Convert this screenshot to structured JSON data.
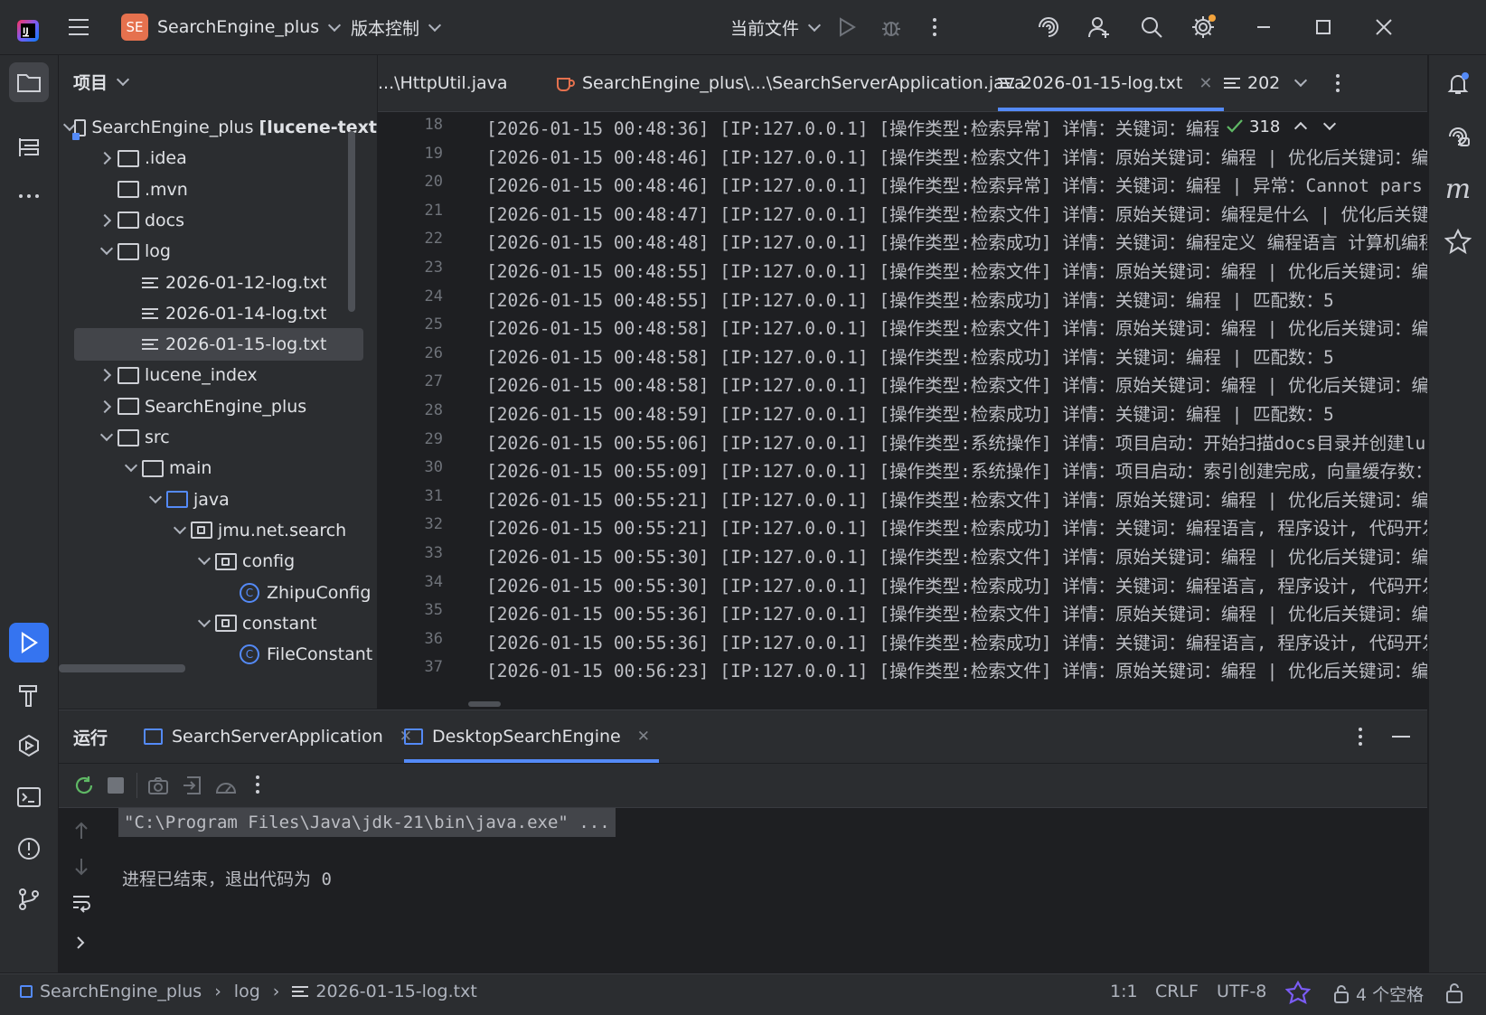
{
  "titlebar": {
    "project_badge": "SE",
    "project_name": "SearchEngine_plus",
    "vcs_menu": "版本控制",
    "run_config": "当前文件"
  },
  "project_panel": {
    "title": "项目",
    "tree": [
      {
        "label": "SearchEngine_plus",
        "suffix": "[lucene-text",
        "kind": "module",
        "level": 0,
        "expanded": true
      },
      {
        "label": ".idea",
        "kind": "folder",
        "level": 1,
        "expanded": false
      },
      {
        "label": ".mvn",
        "kind": "folder",
        "level": 1,
        "expanded": null
      },
      {
        "label": "docs",
        "kind": "folder",
        "level": 1,
        "expanded": false
      },
      {
        "label": "log",
        "kind": "folder",
        "level": 1,
        "expanded": true
      },
      {
        "label": "2026-01-12-log.txt",
        "kind": "file",
        "level": 2
      },
      {
        "label": "2026-01-14-log.txt",
        "kind": "file",
        "level": 2
      },
      {
        "label": "2026-01-15-log.txt",
        "kind": "file",
        "level": 2,
        "selected": true
      },
      {
        "label": "lucene_index",
        "kind": "folder",
        "level": 1,
        "expanded": false
      },
      {
        "label": "SearchEngine_plus",
        "kind": "folder",
        "level": 1,
        "expanded": false
      },
      {
        "label": "src",
        "kind": "folder",
        "level": 1,
        "expanded": true
      },
      {
        "label": "main",
        "kind": "folder",
        "level": 2,
        "expanded": true
      },
      {
        "label": "java",
        "kind": "folder-blue",
        "level": 3,
        "expanded": true
      },
      {
        "label": "jmu.net.search",
        "kind": "package",
        "level": 4,
        "expanded": true
      },
      {
        "label": "config",
        "kind": "package",
        "level": 5,
        "expanded": true
      },
      {
        "label": "ZhipuConfig",
        "kind": "class",
        "level": 6
      },
      {
        "label": "constant",
        "kind": "package",
        "level": 5,
        "expanded": true
      },
      {
        "label": "FileConstant",
        "kind": "class",
        "level": 6
      }
    ]
  },
  "editor_tabs": [
    {
      "label": "...\\HttpUtil.java",
      "active": false
    },
    {
      "label": "SearchEngine_plus\\...\\SearchServerApplication.java",
      "active": false
    },
    {
      "label": "2026-01-15-log.txt",
      "active": true
    },
    {
      "label": "202",
      "active": false
    }
  ],
  "editor": {
    "inspection_count": "318",
    "lines": [
      {
        "n": "18",
        "text": "[2026-01-15 00:48:36] [IP:127.0.0.1] [操作类型:检索异常] 详情：关键词：编程 | 异常："
      },
      {
        "n": "19",
        "text": "[2026-01-15 00:48:46] [IP:127.0.0.1] [操作类型:检索文件] 详情：原始关键词：编程 | 优化后关键词：编"
      },
      {
        "n": "20",
        "text": "[2026-01-15 00:48:46] [IP:127.0.0.1] [操作类型:检索异常] 详情：关键词：编程 | 异常：Cannot pars"
      },
      {
        "n": "21",
        "text": "[2026-01-15 00:48:47] [IP:127.0.0.1] [操作类型:检索文件] 详情：原始关键词：编程是什么 | 优化后关键"
      },
      {
        "n": "22",
        "text": "[2026-01-15 00:48:48] [IP:127.0.0.1] [操作类型:检索成功] 详情：关键词：编程定义 编程语言 计算机编程"
      },
      {
        "n": "23",
        "text": "[2026-01-15 00:48:55] [IP:127.0.0.1] [操作类型:检索文件] 详情：原始关键词：编程 | 优化后关键词：编"
      },
      {
        "n": "24",
        "text": "[2026-01-15 00:48:55] [IP:127.0.0.1] [操作类型:检索成功] 详情：关键词：编程 | 匹配数：5"
      },
      {
        "n": "25",
        "text": "[2026-01-15 00:48:58] [IP:127.0.0.1] [操作类型:检索文件] 详情：原始关键词：编程 | 优化后关键词：编"
      },
      {
        "n": "26",
        "text": "[2026-01-15 00:48:58] [IP:127.0.0.1] [操作类型:检索成功] 详情：关键词：编程 | 匹配数：5"
      },
      {
        "n": "27",
        "text": "[2026-01-15 00:48:58] [IP:127.0.0.1] [操作类型:检索文件] 详情：原始关键词：编程 | 优化后关键词：编"
      },
      {
        "n": "28",
        "text": "[2026-01-15 00:48:59] [IP:127.0.0.1] [操作类型:检索成功] 详情：关键词：编程 | 匹配数：5"
      },
      {
        "n": "29",
        "text": "[2026-01-15 00:55:06] [IP:127.0.0.1] [操作类型:系统操作] 详情：项目启动：开始扫描docs目录并创建lu"
      },
      {
        "n": "30",
        "text": "[2026-01-15 00:55:09] [IP:127.0.0.1] [操作类型:系统操作] 详情：项目启动：索引创建完成，向量缓存数："
      },
      {
        "n": "31",
        "text": "[2026-01-15 00:55:21] [IP:127.0.0.1] [操作类型:检索文件] 详情：原始关键词：编程 | 优化后关键词：编"
      },
      {
        "n": "32",
        "text": "[2026-01-15 00:55:21] [IP:127.0.0.1] [操作类型:检索成功] 详情：关键词：编程语言, 程序设计, 代码开发"
      },
      {
        "n": "33",
        "text": "[2026-01-15 00:55:30] [IP:127.0.0.1] [操作类型:检索文件] 详情：原始关键词：编程 | 优化后关键词：编"
      },
      {
        "n": "34",
        "text": "[2026-01-15 00:55:30] [IP:127.0.0.1] [操作类型:检索成功] 详情：关键词：编程语言, 程序设计, 代码开发"
      },
      {
        "n": "35",
        "text": "[2026-01-15 00:55:36] [IP:127.0.0.1] [操作类型:检索文件] 详情：原始关键词：编程 | 优化后关键词：编"
      },
      {
        "n": "36",
        "text": "[2026-01-15 00:55:36] [IP:127.0.0.1] [操作类型:检索成功] 详情：关键词：编程语言, 程序设计, 代码开发"
      },
      {
        "n": "37",
        "text": "[2026-01-15 00:56:23] [IP:127.0.0.1] [操作类型:检索文件] 详情：原始关键词：编程 | 优化后关键词：编"
      }
    ]
  },
  "run_panel": {
    "title": "运行",
    "tabs": [
      {
        "label": "SearchServerApplication",
        "active": false
      },
      {
        "label": "DesktopSearchEngine",
        "active": true
      }
    ],
    "console": {
      "command": "\"C:\\Program Files\\Java\\jdk-21\\bin\\java.exe\" ...",
      "exit_message": "进程已结束，退出代码为 0"
    }
  },
  "statusbar": {
    "breadcrumb": [
      "SearchEngine_plus",
      "log",
      "2026-01-15-log.txt"
    ],
    "position": "1:1",
    "line_sep": "CRLF",
    "encoding": "UTF-8",
    "indent": "4 个空格"
  },
  "colors": {
    "accent": "#548af7",
    "badge": "#e5714e",
    "success": "#5fb865"
  }
}
